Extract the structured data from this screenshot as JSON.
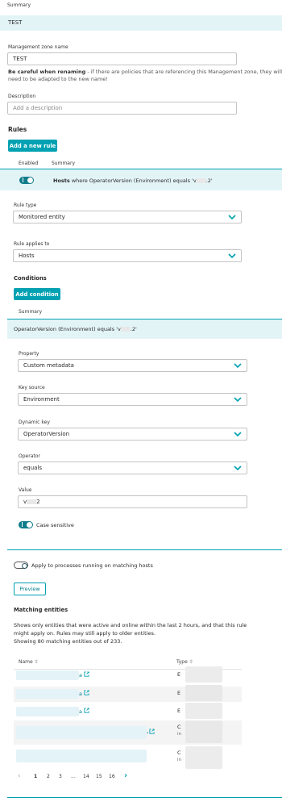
{
  "summary_header": "Summary",
  "zone_title": "TEST",
  "zone_name_label": "Management zone name",
  "zone_name_value": "TEST",
  "warning_bold": "Be careful when renaming",
  "warning_rest": " - if there are policies that are referencing this Management zone, they will",
  "warning_line2": "need to be adapted to the new name!",
  "description_label": "Description",
  "description_placeholder": "Add a description",
  "rules_heading": "Rules",
  "add_rule_button": "Add a new rule",
  "rules_table": {
    "col_enabled": "Enabled",
    "col_summary": "Summary"
  },
  "rule_summary": {
    "entity": "Hosts",
    "text": "where OperatorVersion (Environment) equals 'v",
    "tail": ".2'"
  },
  "rule_type_label": "Rule type",
  "rule_type_value": "Monitored entity",
  "applies_to_label": "Rule applies to",
  "applies_to_value": "Hosts",
  "conditions_heading": "Conditions",
  "add_condition_button": "Add condition",
  "conditions_summary_header": "Summary",
  "condition_summary": {
    "text": "OperatorVersion (Environment) equals 'v",
    "tail": ".2'"
  },
  "property_label": "Property",
  "property_value": "Custom metadata",
  "key_source_label": "Key source",
  "key_source_value": "Environment",
  "dynamic_key_label": "Dynamic key",
  "dynamic_key_value": "OperatorVersion",
  "operator_label": "Operator",
  "operator_value": "equals",
  "value_label": "Value",
  "value_prefix": "v",
  "value_suffix": "2",
  "case_sensitive_label": "Case sensitive",
  "apply_processes_label": "Apply to processes running on matching hosts",
  "preview_button": "Preview",
  "matching_heading": "Matching entities",
  "matching_desc_1": "Shows only entities that were active and online within the last 2 hours, and that this rule",
  "matching_desc_2": "might apply on. Rules may still apply to older entities.",
  "matching_count": "Showing 80 matching entities out of 233.",
  "table_headers": {
    "name": "Name",
    "type": "Type"
  },
  "rows": [
    {
      "name_tail": "a",
      "type": "E"
    },
    {
      "name_tail": "a",
      "type": "E"
    },
    {
      "name_tail": "a",
      "type": "E"
    },
    {
      "name_tail": "",
      "type": "C",
      "type_sub": "in"
    },
    {
      "name_tail": "",
      "type": "C",
      "type_sub": "in"
    }
  ],
  "pagination": [
    "1",
    "2",
    "3",
    "...",
    "14",
    "15",
    "16"
  ],
  "colors": {
    "accent": "#00a1b2",
    "band": "#e3f4f7",
    "toggle_on": "#0f7c8a"
  }
}
